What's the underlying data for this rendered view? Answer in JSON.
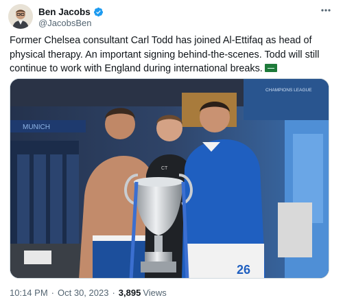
{
  "author": {
    "display_name": "Ben Jacobs",
    "handle": "@JacobsBen",
    "verified_icon": "verified-badge-icon",
    "verified_color": "#1d9bf0"
  },
  "more_icon": "more-horizontal-icon",
  "tweet": {
    "text": "Former Chelsea consultant Carl Todd has joined Al-Ettifaq as head of physical therapy. An important signing behind-the-scenes. Todd will still continue to work with England during international breaks.",
    "emoji_icon": "saudi-arabia-flag-icon"
  },
  "media": {
    "image_icon": "photo-celebration-with-trophy",
    "shirt_number": "26",
    "sign_text": "CHAMPIONS LEAGUE",
    "banner_text": "MUNICH",
    "badge_text": "CT"
  },
  "meta": {
    "time": "10:14 PM",
    "separator": "·",
    "date": "Oct 30, 2023",
    "views_count": "3,895",
    "views_label": "Views"
  }
}
